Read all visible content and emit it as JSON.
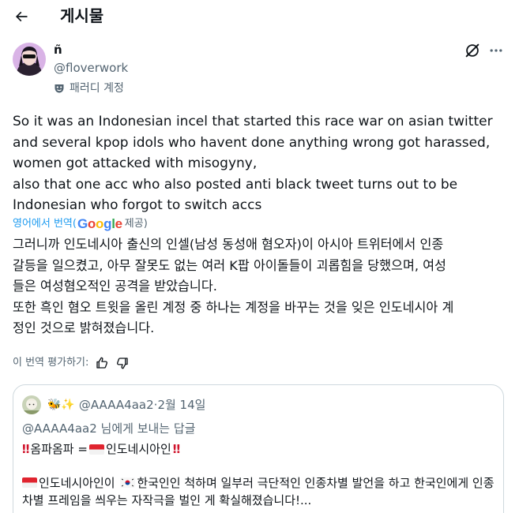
{
  "header": {
    "title": "게시물"
  },
  "author": {
    "display_name": "ñ",
    "handle": "@floverwork",
    "parody_label": "패러디 계정"
  },
  "tweet": {
    "text": "So it was an Indonesian incel that started this race war on asian twitter\nand several kpop idols who havent done anything wrong got harassed,\nwomen got attacked with misogyny,\nalso that one acc who also posted anti black tweet turns out to be\nIndonesian who forgot to switch accs",
    "translate_link": "영어에서 번역(",
    "google_word": "Google",
    "provided_by": " 제공)",
    "translated_text": "그러니까 인도네시아 출신의 인셀(남성 동성애 혐오자)이 아시아 트위터에서 인종\n갈등을 일으켰고, 아무 잘못도 없는 여러 K팝 아이돌들이 괴롭힘을 당했으며, 여성\n들은 여성혐오적인 공격을 받았습니다.\n또한 흑인 혐오 트윗을 올린 계정 중 하나는 계정을 바꾸는 것을 잊은 인도네시아 계\n정인 것으로 밝혀졌습니다.",
    "rate_label": "이 번역 평가하기:"
  },
  "quote": {
    "emojis": "🐝✨",
    "handle": "@AAAA4aa2",
    "separator": " · ",
    "date": "2월 14일",
    "reply_to": "@AAAA4aa2 님에게 보내는 답글",
    "line1_bang_left": "‼",
    "line1_text": "옴파옴파 = ",
    "line1_after_flag": "인도네시아인",
    "line1_bang_right": "‼",
    "line2_part1": "인도네시아인이 ",
    "line2_part2": "한국인인 척하며 일부러 극단적인 인종차별 발언을 하고 한국인에게 인종차별 프레임을 씌우는 자작극을 벌인 게 확실해졌습니다!..."
  },
  "colors": {
    "text_primary": "#0f1419",
    "text_secondary": "#536471",
    "link": "#1d9bf0",
    "border": "#cfd9de",
    "flag_red": "#e0242f"
  },
  "icons": [
    "back-arrow-icon",
    "grok-icon",
    "more-dots-icon",
    "parody-mask-icon",
    "thumbs-up-icon",
    "thumbs-down-icon"
  ]
}
